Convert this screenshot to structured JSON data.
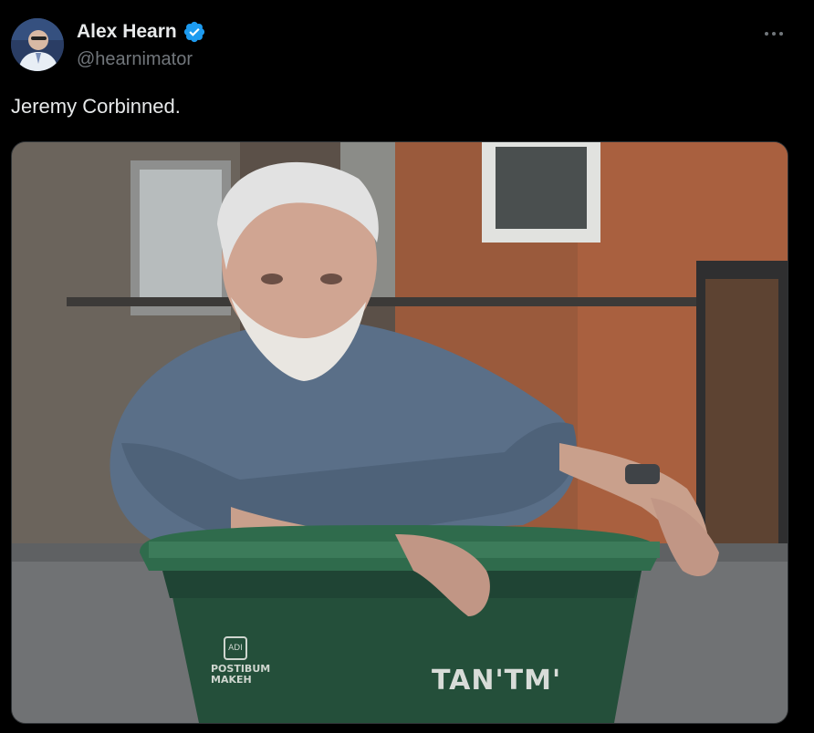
{
  "author": {
    "name": "Alex Hearn",
    "handle": "@hearnimator",
    "verified_color": "#1d9bf0"
  },
  "tweet": {
    "text": "Jeremy Corbinned."
  },
  "media": {
    "bin_label": "TAN'TM'",
    "bin_small_label": "POSTIBUM\nMAKEH",
    "bin_logo_text": "ADI"
  },
  "icons": {
    "more": "more-horizontal-icon",
    "verified": "verified-badge-icon"
  }
}
